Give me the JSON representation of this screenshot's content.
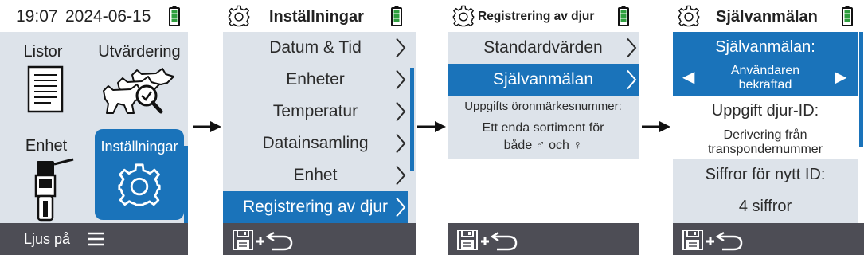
{
  "colors": {
    "accent": "#1a73ba",
    "panel": "#dde3ea",
    "footer": "#4d4d55",
    "battery": "#2e9e3e"
  },
  "screen1": {
    "time": "19:07",
    "date": "2024-06-15",
    "tiles": [
      {
        "label": "Listor",
        "icon": "list-document-icon"
      },
      {
        "label": "Utvärdering",
        "icon": "cattle-magnifier-icon"
      },
      {
        "label": "Enhet",
        "icon": "handheld-reader-icon"
      },
      {
        "label": "Inställningar",
        "icon": "gear-icon",
        "selected": true
      }
    ],
    "footer": {
      "light_label": "Ljus på",
      "menu_icon": "hamburger-menu-icon"
    }
  },
  "screen2": {
    "title": "Inställningar",
    "items": [
      {
        "label": "Datum & Tid"
      },
      {
        "label": "Enheter"
      },
      {
        "label": "Temperatur"
      },
      {
        "label": "Datainsamling"
      },
      {
        "label": "Enhet"
      },
      {
        "label": "Registrering av djur",
        "selected": true
      }
    ],
    "footer": {
      "actions": "save-plus-back-icon"
    }
  },
  "screen3": {
    "title": "Registrering av djur",
    "items": [
      {
        "label": "Standardvärden"
      },
      {
        "label": "Självanmälan",
        "selected": true
      }
    ],
    "info": {
      "heading": "Uppgifts öronmärkesnummer:",
      "value_line1": "Ett enda sortiment för",
      "value_line2": "både ♂ och ♀"
    },
    "footer": {
      "actions": "save-plus-back-icon"
    }
  },
  "screen4": {
    "title": "Självanmälan",
    "selector": {
      "label": "Självanmälan:",
      "value_line1": "Användaren",
      "value_line2": "bekräftad",
      "left_arrow": "◀",
      "right_arrow": "▶"
    },
    "djur_id": {
      "label": "Uppgift djur-ID:",
      "value_line1": "Derivering från",
      "value_line2": "transpondernummer"
    },
    "digits": {
      "label": "Siffror för nytt ID:",
      "value": "4 siffror"
    },
    "footer": {
      "actions": "save-plus-back-icon"
    }
  }
}
